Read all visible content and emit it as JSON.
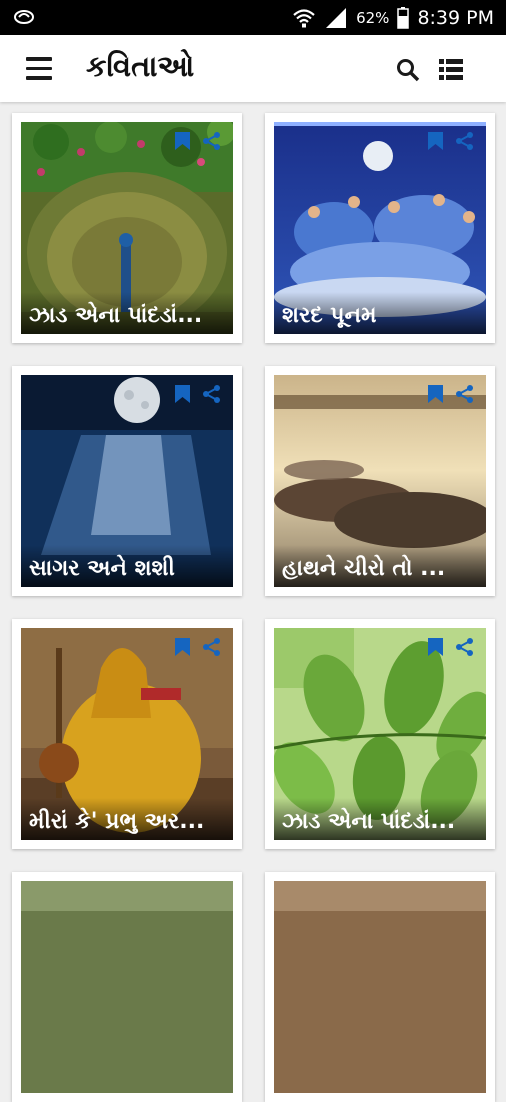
{
  "status_bar": {
    "battery_percent": "62%",
    "time": "8:39 PM"
  },
  "app_bar": {
    "title": "કવિતાઓ"
  },
  "cards": [
    {
      "title": "ઝાડ એના પાંદડાં..."
    },
    {
      "title": "શરદ પૂનમ"
    },
    {
      "title": "સાગર અને શશી"
    },
    {
      "title": "હાથને ચીરો તો ..."
    },
    {
      "title": "મીરાં કે' પ્રભુ અર..."
    },
    {
      "title": "ઝાડ એના પાંદડાં..."
    }
  ],
  "colors": {
    "accent": "#1565c0",
    "status_bar": "#000000",
    "app_bar": "#ffffff"
  }
}
